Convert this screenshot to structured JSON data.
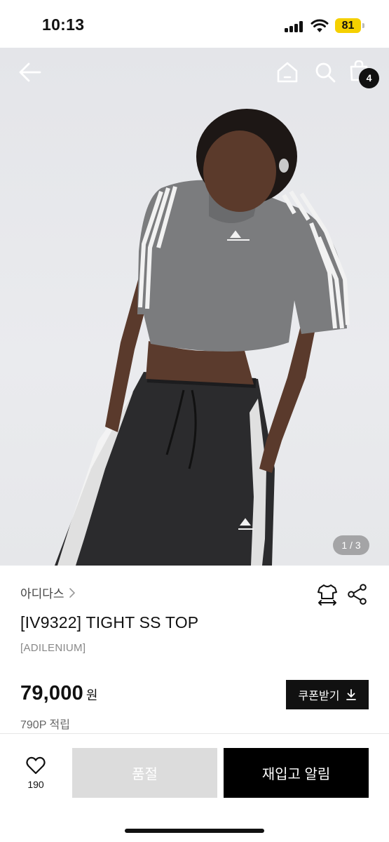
{
  "status_bar": {
    "time": "10:13",
    "battery": "81"
  },
  "nav": {
    "cart_count": "4"
  },
  "gallery": {
    "counter": "1 / 3"
  },
  "product": {
    "brand": "아디다스",
    "title": "[IV9322] TIGHT SS TOP",
    "subtitle": "[ADILENIUM]",
    "price": "79,000",
    "currency": "원",
    "points": "790P 적립"
  },
  "actions": {
    "coupon_label": "쿠폰받기",
    "wishlist_count": "190",
    "soldout_label": "품절",
    "restock_label": "재입고 알림"
  },
  "icons": [
    "back-arrow-icon",
    "home-icon",
    "search-icon",
    "shopping-bag-icon",
    "chevron-right-icon",
    "size-guide-icon",
    "share-icon",
    "download-icon",
    "heart-icon",
    "signal-icon",
    "wifi-icon",
    "battery-icon"
  ],
  "colors": {
    "battery": "#f5d000",
    "primary_button": "#000000",
    "disabled_button": "#dcdcdc"
  }
}
